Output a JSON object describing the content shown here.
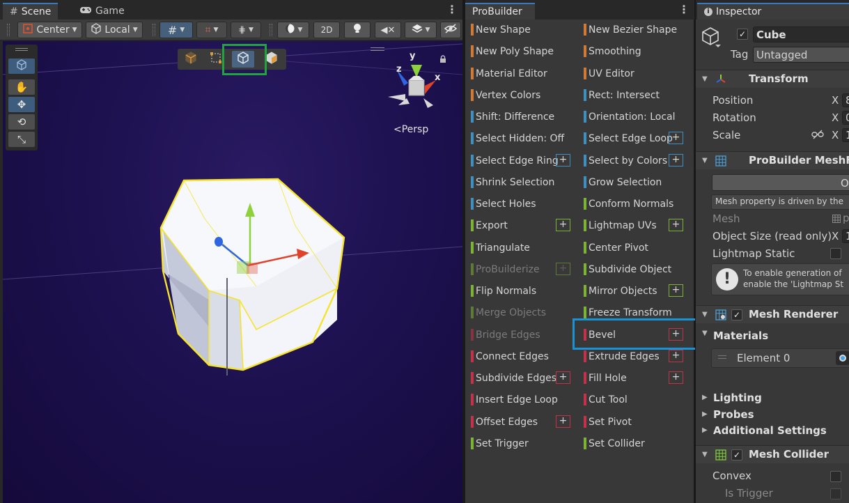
{
  "scene": {
    "tabs": [
      {
        "icon": "hash-icon",
        "label": "Scene"
      },
      {
        "icon": "gamepad-icon",
        "label": "Game"
      }
    ],
    "toolbar": {
      "pivot_mode": "Center",
      "pivot_rotation": "Local",
      "mode_2d": "2D"
    },
    "view_label": "Persp",
    "gizmo_axes": {
      "y": "y",
      "x": "x",
      "z": "z"
    },
    "colors": {
      "x_axis": "#e0432a",
      "y_axis": "#8fd13b",
      "z_axis": "#2f66e0",
      "selection_outline": "#f5e32c",
      "mode_highlight": "#22a33e"
    }
  },
  "probuilder": {
    "tab_label": "ProBuilder",
    "categories": {
      "selection": "#3f8fc0",
      "object": "#d07a35",
      "geometry": "#c2324a",
      "element": "#7cb335"
    },
    "left_column": [
      {
        "label": "New Shape",
        "cat": "object",
        "plus": false,
        "disabled": false
      },
      {
        "label": "New Poly Shape",
        "cat": "object",
        "plus": false,
        "disabled": false
      },
      {
        "label": "Material Editor",
        "cat": "object",
        "plus": false,
        "disabled": false
      },
      {
        "label": "Vertex Colors",
        "cat": "object",
        "plus": false,
        "disabled": false
      },
      {
        "label": "Shift: Difference",
        "cat": "selection",
        "plus": false,
        "disabled": false
      },
      {
        "label": "Select Hidden: Off",
        "cat": "selection",
        "plus": false,
        "disabled": false
      },
      {
        "label": "Select Edge Ring",
        "cat": "selection",
        "plus": true,
        "disabled": false
      },
      {
        "label": "Shrink Selection",
        "cat": "selection",
        "plus": false,
        "disabled": false
      },
      {
        "label": "Select Holes",
        "cat": "selection",
        "plus": false,
        "disabled": false
      },
      {
        "label": "Export",
        "cat": "element",
        "plus": true,
        "disabled": false
      },
      {
        "label": "Triangulate",
        "cat": "element",
        "plus": false,
        "disabled": false
      },
      {
        "label": "ProBuilderize",
        "cat": "element",
        "plus": true,
        "disabled": true
      },
      {
        "label": "Flip Normals",
        "cat": "element",
        "plus": false,
        "disabled": false
      },
      {
        "label": "Merge Objects",
        "cat": "element",
        "plus": false,
        "disabled": true
      },
      {
        "label": "Bridge Edges",
        "cat": "geometry",
        "plus": false,
        "disabled": true
      },
      {
        "label": "Connect Edges",
        "cat": "geometry",
        "plus": false,
        "disabled": false
      },
      {
        "label": "Subdivide Edges",
        "cat": "geometry",
        "plus": true,
        "disabled": false
      },
      {
        "label": "Insert Edge Loop",
        "cat": "geometry",
        "plus": false,
        "disabled": false
      },
      {
        "label": "Offset Edges",
        "cat": "geometry",
        "plus": true,
        "disabled": false
      },
      {
        "label": "Set Trigger",
        "cat": "element",
        "plus": false,
        "disabled": false
      }
    ],
    "right_column": [
      {
        "label": "New Bezier Shape",
        "cat": "object",
        "plus": false,
        "disabled": false
      },
      {
        "label": "Smoothing",
        "cat": "object",
        "plus": false,
        "disabled": false
      },
      {
        "label": "UV Editor",
        "cat": "object",
        "plus": false,
        "disabled": false
      },
      {
        "label": "Rect: Intersect",
        "cat": "selection",
        "plus": false,
        "disabled": false
      },
      {
        "label": "Orientation: Local",
        "cat": "selection",
        "plus": false,
        "disabled": false
      },
      {
        "label": "Select Edge Loop",
        "cat": "selection",
        "plus": true,
        "disabled": false
      },
      {
        "label": "Select by Colors",
        "cat": "selection",
        "plus": true,
        "disabled": false
      },
      {
        "label": "Grow Selection",
        "cat": "selection",
        "plus": false,
        "disabled": false
      },
      {
        "label": "Conform Normals",
        "cat": "element",
        "plus": false,
        "disabled": false
      },
      {
        "label": "Lightmap UVs",
        "cat": "element",
        "plus": true,
        "disabled": false
      },
      {
        "label": "Center Pivot",
        "cat": "element",
        "plus": false,
        "disabled": false
      },
      {
        "label": "Subdivide Object",
        "cat": "element",
        "plus": false,
        "disabled": false
      },
      {
        "label": "Mirror Objects",
        "cat": "element",
        "plus": true,
        "disabled": false
      },
      {
        "label": "Freeze Transform",
        "cat": "element",
        "plus": false,
        "disabled": false
      },
      {
        "label": "Bevel",
        "cat": "geometry",
        "plus": true,
        "disabled": false
      },
      {
        "label": "Extrude Edges",
        "cat": "geometry",
        "plus": true,
        "disabled": false
      },
      {
        "label": "Fill Hole",
        "cat": "geometry",
        "plus": true,
        "disabled": false
      },
      {
        "label": "Cut Tool",
        "cat": "geometry",
        "plus": false,
        "disabled": false
      },
      {
        "label": "Set Pivot",
        "cat": "geometry",
        "plus": false,
        "disabled": false
      },
      {
        "label": "Set Collider",
        "cat": "element",
        "plus": false,
        "disabled": false
      }
    ],
    "plus_glyph": "+",
    "highlight_color": "#1a92d6"
  },
  "inspector": {
    "tab_label": "Inspector",
    "object_name": "Cube",
    "tag_label": "Tag",
    "tag_value": "Untagged",
    "transform": {
      "title": "Transform",
      "position_label": "Position",
      "rotation_label": "Rotation",
      "scale_label": "Scale",
      "x_label": "X",
      "position_x": "8",
      "rotation_x": "0",
      "scale_x": "1"
    },
    "mesh_filter": {
      "title": "ProBuilder MeshFilt",
      "open_button": "Ope",
      "note": "Mesh property is driven by the",
      "mesh_label": "Mesh",
      "mesh_value": "p",
      "object_size_label": "Object Size (read only)",
      "object_size_x_label": "X",
      "object_size_x": "1",
      "lightmap_static_label": "Lightmap Static",
      "help_line1": "To enable generation of",
      "help_line2": "enable the 'Lightmap St"
    },
    "mesh_renderer": {
      "title": "Mesh Renderer",
      "materials_label": "Materials",
      "element0_label": "Element 0",
      "lighting_label": "Lighting",
      "probes_label": "Probes",
      "additional_label": "Additional Settings"
    },
    "mesh_collider": {
      "title": "Mesh Collider",
      "convex_label": "Convex",
      "is_trigger_label": "Is Trigger"
    }
  }
}
